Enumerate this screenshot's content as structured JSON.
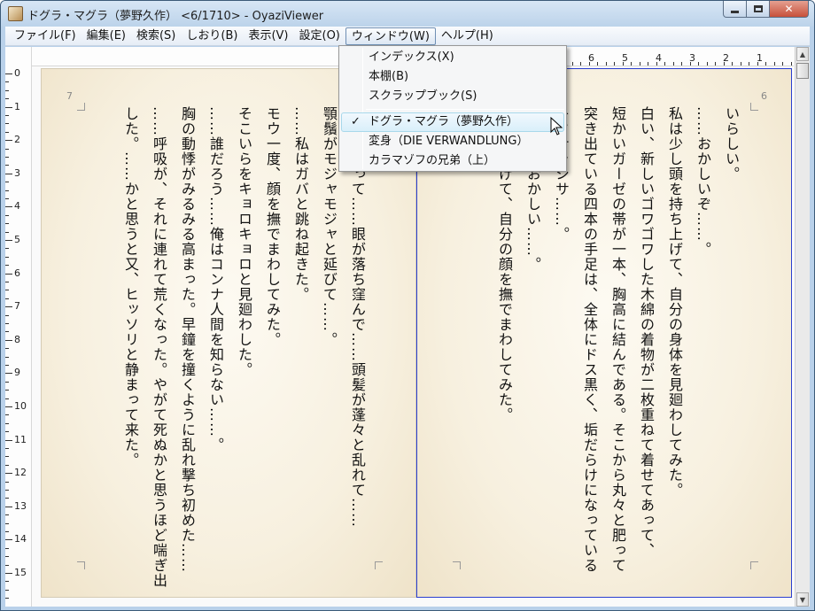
{
  "window": {
    "title": "ドグラ・マグラ（夢野久作） <6/1710> - OyaziViewer"
  },
  "caption": {
    "minimize": "─",
    "maximize": "□",
    "close": "✕"
  },
  "menu": {
    "file": "ファイル(F)",
    "edit": "編集(E)",
    "search": "検索(S)",
    "bookmark": "しおり(B)",
    "view": "表示(V)",
    "settings": "設定(O)",
    "window": "ウィンドウ(W)",
    "help": "ヘルプ(H)"
  },
  "window_menu": {
    "items_top": [
      "インデックス(X)",
      "本棚(B)",
      "スクラップブック(S)"
    ],
    "items_docs": [
      "ドグラ・マグラ（夢野久作）",
      "変身（DIE VERWANDLUNG）",
      "カラマゾフの兄弟（上）"
    ],
    "checked_index": 0,
    "check_mark": "✓"
  },
  "ruler": {
    "vertical": [
      "0",
      "1",
      "2",
      "3",
      "4",
      "5",
      "6",
      "7",
      "8",
      "9",
      "10",
      "11",
      "12",
      "13",
      "14",
      "15"
    ],
    "horizontal": [
      "6",
      "5",
      "4",
      "3",
      "2",
      "1"
    ]
  },
  "left_page": {
    "page_number": "7",
    "columns": [
      "が尖んがって……眼が落ち窪んで……頭髪が蓬々と乱れて……",
      "顎鬚がモジャモジャと延びて……。",
      "……私はガバと跳ね起きた。",
      "モウ一度、顔を撫でまわしてみた。",
      "そこいらをキョロキョロと見廻わした。",
      "……誰だろう……俺はコンナ人間を知らない……。",
      "胸の動悸がみるみる高まった。早鐘を撞くように乱れ撃ち初めた……",
      "……呼吸が、それに連れて荒くなった。やがて死ぬかと思うほど喘ぎ出",
      "した。……かと思うと又、ヒッソリと静まって来た。"
    ]
  },
  "right_page": {
    "page_number": "6",
    "columns": [
      "いらしい。",
      "……おかしいぞ……。",
      "私は少し頭を持ち上げて、自分の身体を見廻わしてみた。",
      "白い、新しいゴワゴワした木綿の着物が二枚重ねて着せてあって、",
      "短かいガーゼの帯が一本、胸高に結んである。そこから丸々と肥って",
      "突き出ている四本の手足は、全体にドス黒く、垢だらけになっている",
      "キタナラシサ……。",
      "いよいよおかしい……。",
      "右手をあげて、自分の顔を撫でまわしてみた。"
    ]
  },
  "scrollbar": {
    "up": "▲",
    "down": "▼"
  }
}
